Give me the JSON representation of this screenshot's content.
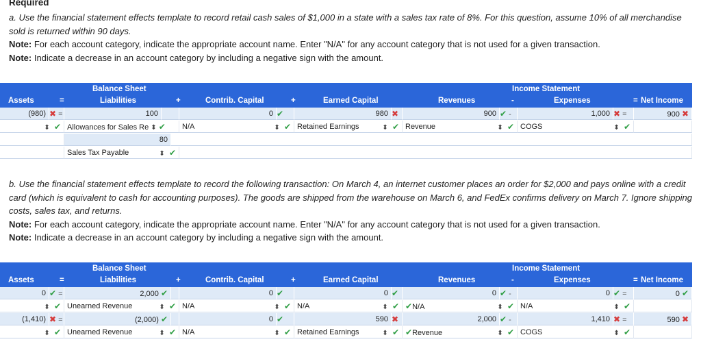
{
  "header": {
    "title": "Required"
  },
  "part_a": {
    "prompt": "a. Use the financial statement effects template to record retail cash sales of $1,000 in a state with a sales tax rate of 8%. For this question, assume 10% of all merchandise sold is returned within 90 days.",
    "note1_label": "Note:",
    "note1": " For each account category, indicate the appropriate account name. Enter \"N/A\" for any account category that is not used for a given transaction.",
    "note2_label": "Note:",
    "note2": " Indicate a decrease in an account category by including a negative sign with the amount."
  },
  "part_b": {
    "prompt": "b. Use the financial statement effects template to record the following transaction: On March 4, an internet customer places an order for $2,000 and pays online with a credit card (which is equivalent to cash for accounting purposes). The goods are shipped from the warehouse on March 6, and FedEx confirms delivery on March 7. Ignore shipping costs, sales tax, and returns.",
    "note1_label": "Note:",
    "note1": " For each account category, indicate the appropriate account name. Enter \"N/A\" for any account category that is not used for a given transaction.",
    "note2_label": "Note:",
    "note2": " Indicate a decrease in an account category by including a negative sign with the amount."
  },
  "template_headers": {
    "balance_sheet": "Balance Sheet",
    "income_statement": "Income Statement",
    "assets": "Assets",
    "eq": "=",
    "liabilities": "Liabilities",
    "plus1": "+",
    "contrib": "Contrib. Capital",
    "plus2": "+",
    "earned": "Earned Capital",
    "revenues": "Revenues",
    "minus": "-",
    "expenses": "Expenses",
    "eq2": "=",
    "net_income": "Net Income"
  },
  "symbols": {
    "ok": "✔",
    "bad": "✖",
    "spin": "⬍",
    "eq": "=",
    "minus": "-"
  },
  "table_a": {
    "r1": {
      "assets": "(980)",
      "liab": "100",
      "contrib": "0",
      "earned": "980",
      "rev": "900",
      "exp": "1,000",
      "ni": "900"
    },
    "r2": {
      "liab_acct": "Allowances for Sales Re",
      "contrib_acct": "N/A",
      "earned_acct": "Retained Earnings",
      "rev_acct": "Revenue",
      "exp_acct": "COGS"
    },
    "r3": {
      "liab": "80"
    },
    "r4": {
      "liab_acct": "Sales Tax Payable"
    }
  },
  "table_b": {
    "r1": {
      "assets": "0",
      "liab": "2,000",
      "contrib": "0",
      "earned": "0",
      "rev": "0",
      "exp": "0",
      "ni": "0"
    },
    "r2": {
      "liab_acct": "Unearned Revenue",
      "contrib_acct": "N/A",
      "earned_acct": "N/A",
      "rev_acct": "N/A",
      "exp_acct": "N/A"
    },
    "r3": {
      "assets": "(1,410)",
      "liab": "(2,000)",
      "contrib": "0",
      "earned": "590",
      "rev": "2,000",
      "exp": "1,410",
      "ni": "590"
    },
    "r4": {
      "liab_acct": "Unearned Revenue",
      "contrib_acct": "N/A",
      "earned_acct": "Retained Earnings",
      "rev_acct": "Revenue",
      "exp_acct": "COGS"
    }
  }
}
